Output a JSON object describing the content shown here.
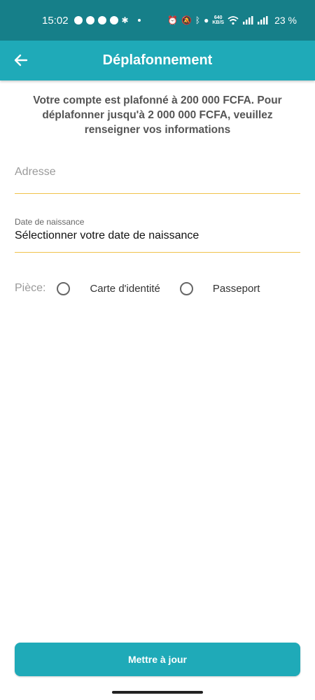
{
  "status_bar": {
    "time": "15:02",
    "net_speed_value": "640",
    "net_speed_unit": "KB/S",
    "battery": "23 %"
  },
  "app_bar": {
    "title": "Déplafonnement",
    "back_icon": "arrow-left-icon"
  },
  "intro_text": "Votre compte est plafonné à 200 000 FCFA. Pour déplafonner jusqu'à 2 000 000 FCFA, veuillez renseigner vos informations",
  "address": {
    "placeholder": "Adresse",
    "value": ""
  },
  "birth_date": {
    "label": "Date de naissance",
    "value": "Sélectionner votre date de naissance"
  },
  "piece": {
    "label": "Pièce:",
    "options": [
      "Carte d'identité",
      "Passeport"
    ]
  },
  "submit_label": "Mettre à jour",
  "colors": {
    "status_bar": "#167f89",
    "primary": "#1faab8",
    "underline": "#f0c24b"
  }
}
